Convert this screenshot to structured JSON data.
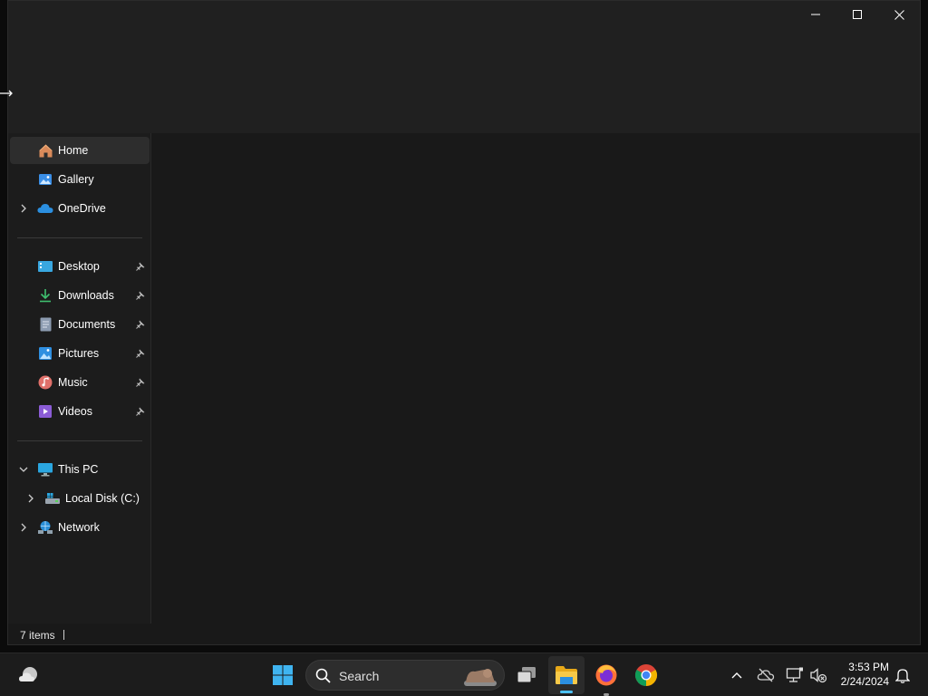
{
  "window": {
    "controls": {
      "minimize": "minimize-icon",
      "maximize": "maximize-icon",
      "close": "close-icon"
    }
  },
  "nav": {
    "quick": [
      {
        "label": "Home",
        "icon": "home-icon",
        "selected": true
      },
      {
        "label": "Gallery",
        "icon": "gallery-icon"
      },
      {
        "label": "OneDrive",
        "icon": "onedrive-cloud-icon",
        "expandable": true
      }
    ],
    "pinned": [
      {
        "label": "Desktop",
        "icon": "desktop-folder-icon"
      },
      {
        "label": "Downloads",
        "icon": "downloads-icon"
      },
      {
        "label": "Documents",
        "icon": "documents-icon"
      },
      {
        "label": "Pictures",
        "icon": "pictures-icon"
      },
      {
        "label": "Music",
        "icon": "music-icon"
      },
      {
        "label": "Videos",
        "icon": "videos-icon"
      }
    ],
    "devices": [
      {
        "label": "This PC",
        "icon": "this-pc-icon",
        "expanded": true
      },
      {
        "label": "Local Disk (C:)",
        "icon": "local-disk-icon",
        "expandable": true
      },
      {
        "label": "Network",
        "icon": "network-icon",
        "expandable": true
      }
    ]
  },
  "statusbar": {
    "item_count": "7 items"
  },
  "taskbar": {
    "search_label": "Search",
    "clock_time": "3:53 PM",
    "clock_date": "2/24/2024",
    "accent": "#4cc2ff"
  }
}
